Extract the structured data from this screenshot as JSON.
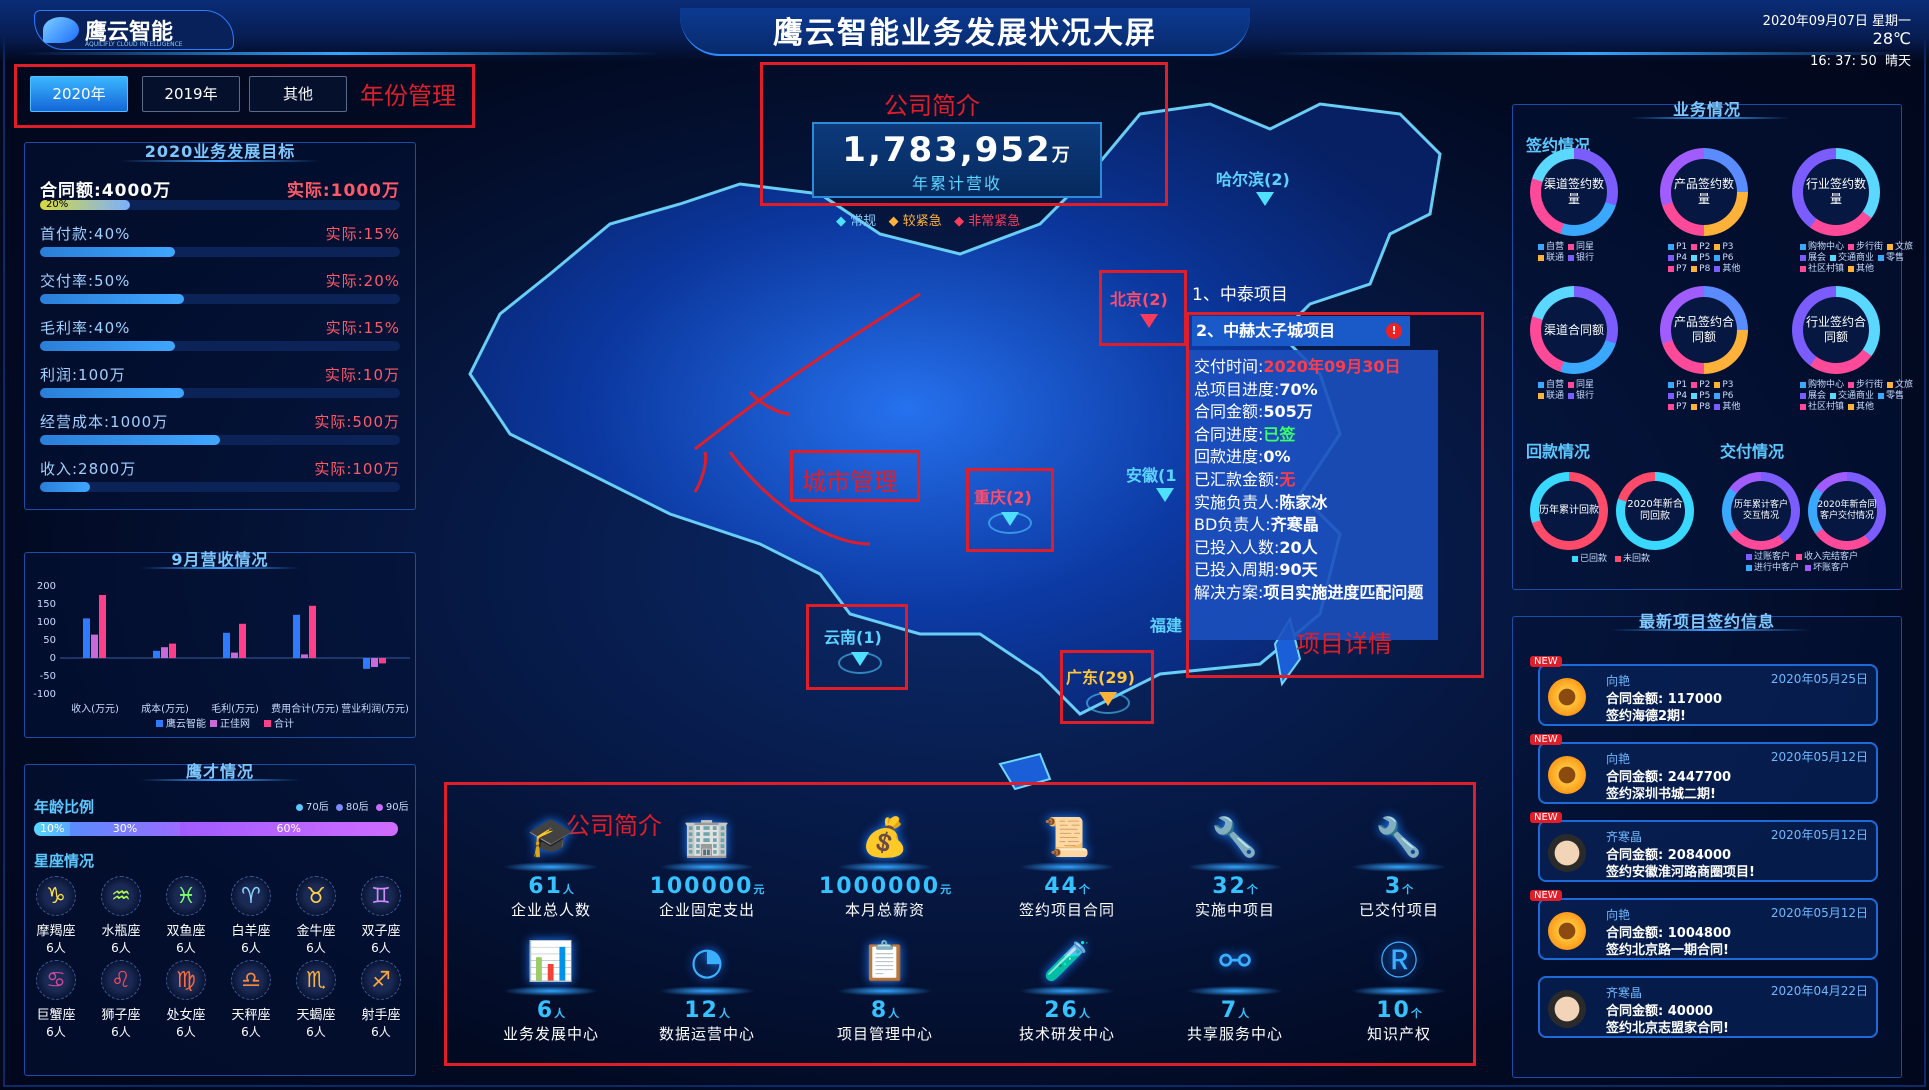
{
  "header": {
    "logo_name": "鹰云智能",
    "logo_sub": "AQUILIFLY CLOUD INTELLIGENCE",
    "title": "鹰云智能业务发展状况大屏",
    "date": "2020年09月07日",
    "weekday": "星期一",
    "temperature": "28℃",
    "time": "16: 37: 50",
    "weather": "晴天"
  },
  "year_tabs": [
    "2020年",
    "2019年",
    "其他"
  ],
  "annotations": {
    "year_mgmt": "年份管理",
    "company_intro_top": "公司简介",
    "city_mgmt": "城市管理",
    "project_detail": "项目详情",
    "company_intro_bottom": "公司简介"
  },
  "goals": {
    "title": "2020业务发展目标",
    "rows": [
      {
        "label": "合同额:4000万",
        "actual": "实际:1000万",
        "pct": "20%",
        "fill": 0.25
      },
      {
        "label": "首付款:40%",
        "actual": "实际:15%",
        "fill": 0.375
      },
      {
        "label": "交付率:50%",
        "actual": "实际:20%",
        "fill": 0.4
      },
      {
        "label": "毛利率:40%",
        "actual": "实际:15%",
        "fill": 0.375
      },
      {
        "label": "利润:100万",
        "actual": "实际:10万",
        "fill": 0.4
      },
      {
        "label": "经营成本:1000万",
        "actual": "实际:500万",
        "fill": 0.5
      },
      {
        "label": "收入:2800万",
        "actual": "实际:100万",
        "fill": 0.14
      }
    ]
  },
  "revenue_chart": {
    "title": "9月营收情况"
  },
  "chart_data": {
    "type": "bar",
    "title": "9月营收情况",
    "categories": [
      "收入(万元)",
      "成本(万元)",
      "毛利(万元)",
      "费用合计(万元)",
      "营业利润(万元)"
    ],
    "series": [
      {
        "name": "鹰云智能",
        "color": "#2f7bff",
        "values": [
          110,
          20,
          70,
          120,
          -30
        ]
      },
      {
        "name": "正佳网",
        "color": "#c86bd8",
        "values": [
          65,
          30,
          15,
          10,
          -25
        ]
      },
      {
        "name": "合计",
        "color": "#ff3f8a",
        "values": [
          175,
          40,
          95,
          145,
          -15
        ]
      }
    ],
    "yticks": [
      200,
      150,
      100,
      50,
      0,
      -50,
      -100
    ],
    "ylim": [
      -100,
      200
    ]
  },
  "talent": {
    "title": "鹰才情况",
    "age_title": "年龄比例",
    "age_legend": [
      "70后",
      "80后",
      "90后"
    ],
    "age": [
      {
        "label": "10%",
        "v": 0.1
      },
      {
        "label": "30%",
        "v": 0.3
      },
      {
        "label": "60%",
        "v": 0.6
      }
    ],
    "zodiac_title": "星座情况",
    "zodiac": [
      {
        "name": "摩羯座",
        "count": "6人",
        "glyph": "♑"
      },
      {
        "name": "水瓶座",
        "count": "6人",
        "glyph": "♒"
      },
      {
        "name": "双鱼座",
        "count": "6人",
        "glyph": "♓"
      },
      {
        "name": "白羊座",
        "count": "6人",
        "glyph": "♈"
      },
      {
        "name": "金牛座",
        "count": "6人",
        "glyph": "♉"
      },
      {
        "name": "双子座",
        "count": "6人",
        "glyph": "♊"
      },
      {
        "name": "巨蟹座",
        "count": "6人",
        "glyph": "♋"
      },
      {
        "name": "狮子座",
        "count": "6人",
        "glyph": "♌"
      },
      {
        "name": "处女座",
        "count": "6人",
        "glyph": "♍"
      },
      {
        "name": "天秤座",
        "count": "6人",
        "glyph": "♎"
      },
      {
        "name": "天蝎座",
        "count": "6人",
        "glyph": "♏"
      },
      {
        "name": "射手座",
        "count": "6人",
        "glyph": "♐"
      }
    ]
  },
  "revenue": {
    "value": "1,783,952",
    "unit": "万",
    "label": "年累计营收",
    "legend": [
      "常规",
      "较紧急",
      "非常紧急"
    ]
  },
  "cities": [
    {
      "label": "哈尔滨(2)"
    },
    {
      "label": "北京(2)"
    },
    {
      "label": "重庆(2)"
    },
    {
      "label": "安徽(1"
    },
    {
      "label": "云南(1)"
    },
    {
      "label": "广东(29)"
    },
    {
      "label": "福建"
    }
  ],
  "popup": {
    "item1": "1、中泰项目",
    "item2": "2、中赫太子城项目",
    "warn": "!",
    "lines": [
      {
        "k": "交付时间:",
        "v": "2020年09月30日",
        "c": "#ff3b4b"
      },
      {
        "k": "总项目进度:",
        "v": "70%",
        "c": "#ffffff"
      },
      {
        "k": "合同金额:",
        "v": "505万",
        "c": "#ffffff"
      },
      {
        "k": "合同进度:",
        "v": "已签",
        "c": "#3dff6a"
      },
      {
        "k": "回款进度:",
        "v": "0%",
        "c": "#ffffff"
      },
      {
        "k": "已汇款金额:",
        "v": "无",
        "c": "#ff3b4b"
      },
      {
        "k": "实施负责人:",
        "v": "陈家冰",
        "c": "#ffffff"
      },
      {
        "k": "BD负责人:",
        "v": "齐寒晶",
        "c": "#ffffff"
      },
      {
        "k": "已投入人数:",
        "v": "20人",
        "c": "#ffffff"
      },
      {
        "k": "已投入周期:",
        "v": "90天",
        "c": "#ffffff"
      },
      {
        "k": "解决方案:",
        "v": "项目实施进度匹配问题",
        "c": "#ffffff"
      }
    ]
  },
  "business": {
    "title": "业务情况",
    "sign_title": "签约情况",
    "donuts_row1": [
      "渠道签约数量",
      "产品签约数量",
      "行业签约数量"
    ],
    "donuts_row2": [
      "渠道合同额",
      "产品签约合同额",
      "行业签约合同额"
    ],
    "legend_channel": [
      "自营",
      "同星",
      "联通",
      "银行"
    ],
    "legend_product": [
      "P1",
      "P2",
      "P3",
      "P4",
      "P5",
      "P6",
      "P7",
      "P8",
      "其他"
    ],
    "legend_industry": [
      "购物中心",
      "步行街",
      "文旅",
      "展会",
      "交通商业",
      "零售",
      "社区村镇",
      "其他"
    ],
    "payback_title": "回款情况",
    "payback": [
      "历年累计回款",
      "2020年新合同回款"
    ],
    "payback_legend": [
      "已回款",
      "未回款"
    ],
    "deliver_title": "交付情况",
    "deliver": [
      "历年累计客户交互情况",
      "2020年新合同客户交付情况"
    ],
    "deliver_legend": [
      "过账客户",
      "收入完结客户",
      "进行中客户",
      "坏账客户"
    ]
  },
  "news": {
    "title": "最新项目签约信息",
    "badge": "NEW",
    "items": [
      {
        "name": "向艳",
        "amount": "合同金额: 117000",
        "msg": "签约海德2期!",
        "date": "2020年05月25日",
        "new": true
      },
      {
        "name": "向艳",
        "amount": "合同金额: 2447700",
        "msg": "签约深圳书城二期!",
        "date": "2020年05月12日",
        "new": true
      },
      {
        "name": "齐寒晶",
        "amount": "合同金额: 2084000",
        "msg": "签约安徽淮河路商圈项目!",
        "date": "2020年05月12日",
        "new": true
      },
      {
        "name": "向艳",
        "amount": "合同金额: 1004800",
        "msg": "签约北京路一期合同!",
        "date": "2020年05月12日",
        "new": true
      },
      {
        "name": "齐寒晶",
        "amount": "合同金额: 40000",
        "msg": "签约北京志盟家合同!",
        "date": "2020年04月22日",
        "new": false
      }
    ]
  },
  "stats": {
    "row1": [
      {
        "value": "61",
        "unit": "人",
        "label": "企业总人数",
        "glyph": "🎓"
      },
      {
        "value": "100000",
        "unit": "元",
        "label": "企业固定支出",
        "glyph": "🏢"
      },
      {
        "value": "1000000",
        "unit": "元",
        "label": "本月总薪资",
        "glyph": "💰"
      },
      {
        "value": "44",
        "unit": "个",
        "label": "签约项目合同",
        "glyph": "📜"
      },
      {
        "value": "32",
        "unit": "个",
        "label": "实施中项目",
        "glyph": "🔧"
      },
      {
        "value": "3",
        "unit": "个",
        "label": "已交付项目",
        "glyph": "🔧"
      }
    ],
    "row2": [
      {
        "value": "6",
        "unit": "人",
        "label": "业务发展中心",
        "glyph": "📊"
      },
      {
        "value": "12",
        "unit": "人",
        "label": "数据运营中心",
        "glyph": "◔"
      },
      {
        "value": "8",
        "unit": "人",
        "label": "项目管理中心",
        "glyph": "📋"
      },
      {
        "value": "26",
        "unit": "人",
        "label": "技术研发中心",
        "glyph": "🧪"
      },
      {
        "value": "7",
        "unit": "人",
        "label": "共享服务中心",
        "glyph": "⚯"
      },
      {
        "value": "10",
        "unit": "个",
        "label": "知识产权",
        "glyph": "Ⓡ"
      }
    ]
  }
}
